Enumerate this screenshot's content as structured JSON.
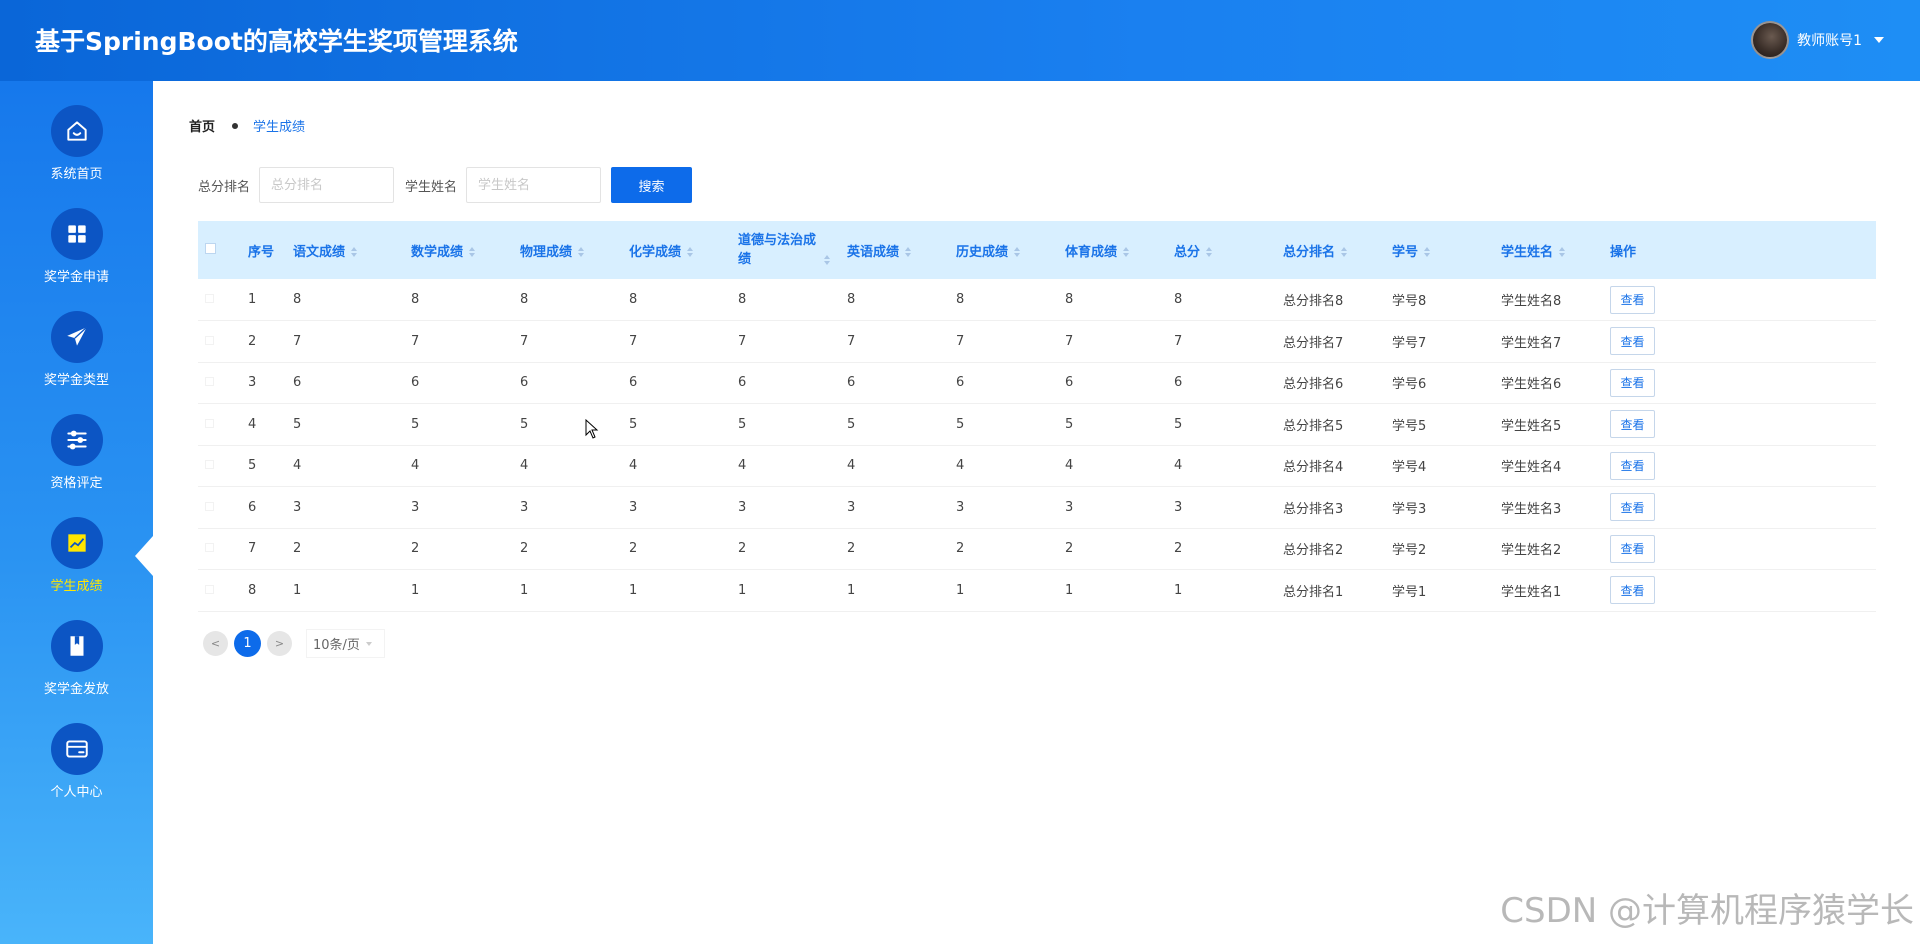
{
  "header": {
    "title": "基于SpringBoot的高校学生奖项管理系统",
    "user_name": "教师账号1"
  },
  "sidebar": {
    "items": [
      {
        "label": "系统首页",
        "icon": "home-icon"
      },
      {
        "label": "奖学金申请",
        "icon": "grid-icon"
      },
      {
        "label": "奖学金类型",
        "icon": "paper-plane-icon"
      },
      {
        "label": "资格评定",
        "icon": "sliders-icon"
      },
      {
        "label": "学生成绩",
        "icon": "chart-icon",
        "active": true
      },
      {
        "label": "奖学金发放",
        "icon": "book-icon"
      },
      {
        "label": "个人中心",
        "icon": "card-icon"
      }
    ]
  },
  "breadcrumb": {
    "home": "首页",
    "current": "学生成绩"
  },
  "search": {
    "rank_label": "总分排名",
    "rank_placeholder": "总分排名",
    "rank_value": "",
    "name_label": "学生姓名",
    "name_placeholder": "学生姓名",
    "name_value": "",
    "button_label": "搜索"
  },
  "table": {
    "columns": [
      "序号",
      "语文成绩",
      "数学成绩",
      "物理成绩",
      "化学成绩",
      "道德与法治成绩",
      "英语成绩",
      "历史成绩",
      "体育成绩",
      "总分",
      "总分排名",
      "学号",
      "学生姓名",
      "操作"
    ],
    "rows": [
      [
        "1",
        "8",
        "8",
        "8",
        "8",
        "8",
        "8",
        "8",
        "8",
        "8",
        "总分排名8",
        "学号8",
        "学生姓名8",
        "查看"
      ],
      [
        "2",
        "7",
        "7",
        "7",
        "7",
        "7",
        "7",
        "7",
        "7",
        "7",
        "总分排名7",
        "学号7",
        "学生姓名7",
        "查看"
      ],
      [
        "3",
        "6",
        "6",
        "6",
        "6",
        "6",
        "6",
        "6",
        "6",
        "6",
        "总分排名6",
        "学号6",
        "学生姓名6",
        "查看"
      ],
      [
        "4",
        "5",
        "5",
        "5",
        "5",
        "5",
        "5",
        "5",
        "5",
        "5",
        "总分排名5",
        "学号5",
        "学生姓名5",
        "查看"
      ],
      [
        "5",
        "4",
        "4",
        "4",
        "4",
        "4",
        "4",
        "4",
        "4",
        "4",
        "总分排名4",
        "学号4",
        "学生姓名4",
        "查看"
      ],
      [
        "6",
        "3",
        "3",
        "3",
        "3",
        "3",
        "3",
        "3",
        "3",
        "3",
        "总分排名3",
        "学号3",
        "学生姓名3",
        "查看"
      ],
      [
        "7",
        "2",
        "2",
        "2",
        "2",
        "2",
        "2",
        "2",
        "2",
        "2",
        "总分排名2",
        "学号2",
        "学生姓名2",
        "查看"
      ],
      [
        "8",
        "1",
        "1",
        "1",
        "1",
        "1",
        "1",
        "1",
        "1",
        "1",
        "总分排名1",
        "学号1",
        "学生姓名1",
        "查看"
      ]
    ]
  },
  "pagination": {
    "prev": "<",
    "current_page": "1",
    "next": ">",
    "page_size": "10条/页"
  },
  "watermark": "CSDN @计算机程序猿学长",
  "colors": {
    "primary": "#0d6bea",
    "active_nav": "#ffe600",
    "header_row": "#d8efff"
  }
}
